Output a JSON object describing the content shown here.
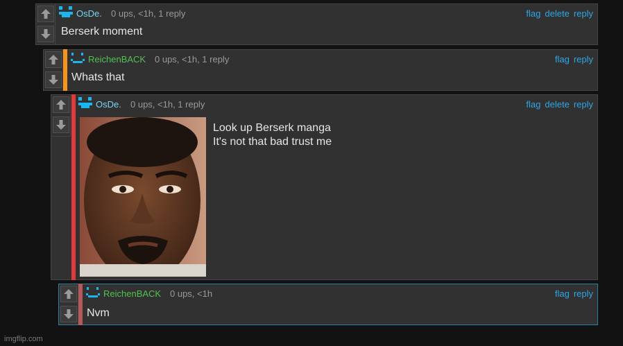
{
  "comments": [
    {
      "username": "OsDe.",
      "meta": "0 ups, <1h, 1 reply",
      "actions": [
        "flag",
        "delete",
        "reply"
      ],
      "text": "Berserk moment",
      "accent": "none"
    },
    {
      "username": "ReichenBACK",
      "meta": "0 ups, <1h, 1 reply",
      "actions": [
        "flag",
        "reply"
      ],
      "text": "Whats that",
      "accent": "#f7941d"
    },
    {
      "username": "OsDe.",
      "meta": "0 ups, <1h, 1 reply",
      "actions": [
        "flag",
        "delete",
        "reply"
      ],
      "text_lines": [
        "Look up Berserk manga",
        "It's not that bad trust me"
      ],
      "image": "meme-image-man-face",
      "accent": "#e03a3a"
    },
    {
      "username": "ReichenBACK",
      "meta": "0 ups, <1h",
      "actions": [
        "flag",
        "reply"
      ],
      "text": "Nvm",
      "accent": "#b45a5a"
    }
  ],
  "colors": {
    "background": "#121212",
    "panel": "#313131",
    "link": "#2ea6e6",
    "username_blue": "#7ad4f5",
    "username_green": "#53c153"
  },
  "watermark": "imgflip.com"
}
